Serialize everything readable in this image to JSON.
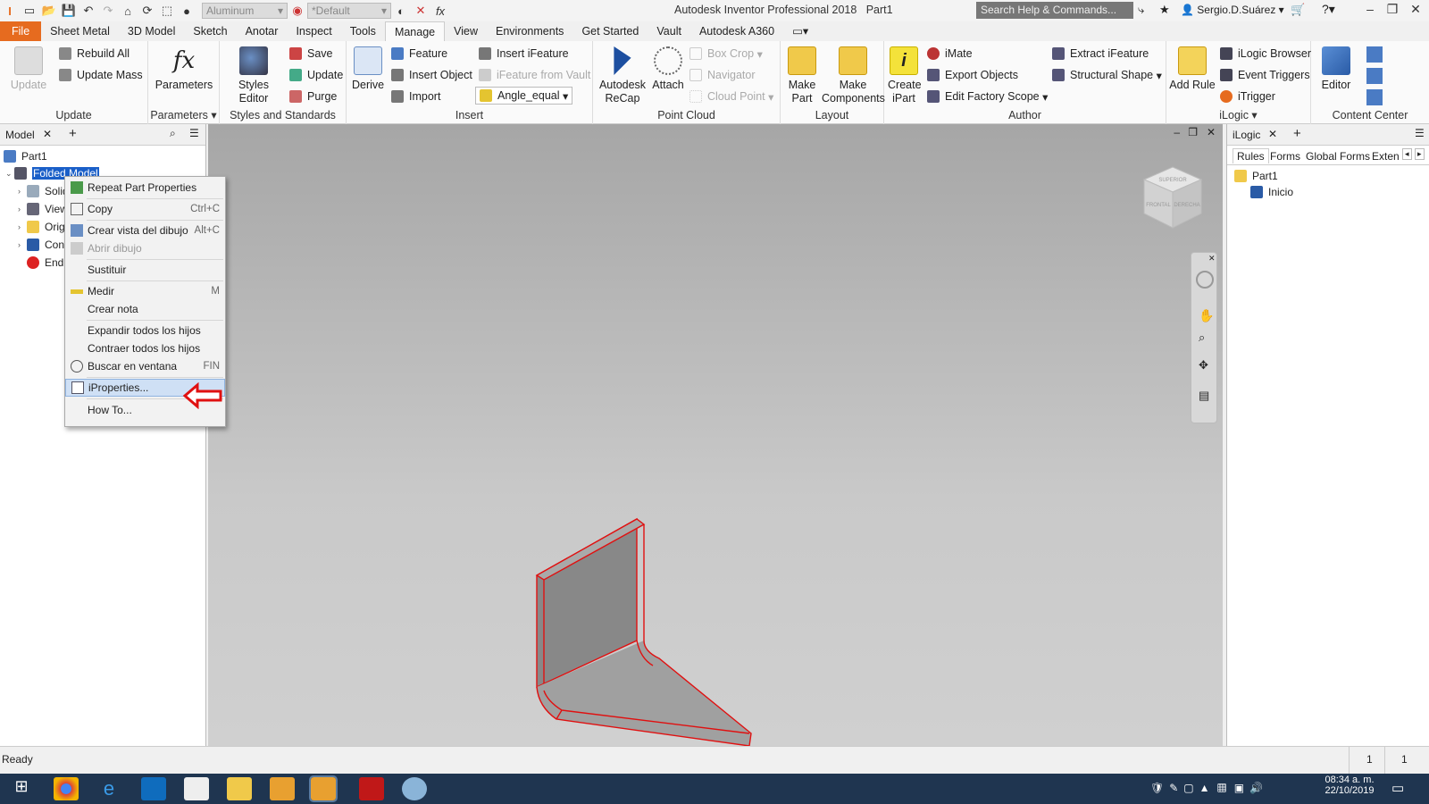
{
  "app": {
    "title": "Autodesk Inventor Professional 2018",
    "document": "Part1",
    "search_placeholder": "Search Help & Commands...",
    "user": "Sergio.D.Suárez",
    "material": "Aluminum",
    "appearance": "*Default"
  },
  "tabs": [
    "File",
    "Sheet Metal",
    "3D Model",
    "Sketch",
    "Anotar",
    "Inspect",
    "Tools",
    "Manage",
    "View",
    "Environments",
    "Get Started",
    "Vault",
    "Autodesk A360"
  ],
  "active_tab": "Manage",
  "ribbon": {
    "update": {
      "label": "Update",
      "rebuild_all": "Rebuild All",
      "update_mass": "Update Mass",
      "group": "Update"
    },
    "parameters": {
      "label": "Parameters",
      "group": "Parameters"
    },
    "styles": {
      "styles_editor": "Styles Editor",
      "save": "Save",
      "update": "Update",
      "purge": "Purge",
      "group": "Styles and Standards"
    },
    "insert": {
      "derive": "Derive",
      "feature": "Feature",
      "insert_object": "Insert Object",
      "import": "Import",
      "insert_ifeature": "Insert iFeature",
      "ifeature_from_vault": "iFeature from Vault",
      "angle_dropdown": "Angle_equal",
      "group": "Insert"
    },
    "point_cloud": {
      "recap": "Autodesk ReCap",
      "attach": "Attach",
      "box_crop": "Box Crop",
      "navigator": "Navigator",
      "cloud_point": "Cloud Point",
      "group": "Point Cloud"
    },
    "layout": {
      "make_part": "Make Part",
      "make_components": "Make Components",
      "group": "Layout"
    },
    "author": {
      "create_ipart": "Create iPart",
      "imate": "iMate",
      "export_objects": "Export Objects",
      "edit_factory_scope": "Edit Factory Scope",
      "extract_ifeature": "Extract iFeature",
      "structural_shape": "Structural Shape",
      "group": "Author"
    },
    "ilogic": {
      "add_rule": "Add Rule",
      "browser": "iLogic Browser",
      "event_triggers": "Event Triggers",
      "itrigger": "iTrigger",
      "group": "iLogic"
    },
    "content_center": {
      "editor": "Editor",
      "group": "Content Center"
    }
  },
  "model_panel": {
    "tab": "Model",
    "root": "Part1",
    "items": [
      "Folded Model",
      "Solid",
      "View",
      "Orig",
      "Con",
      "End"
    ]
  },
  "context_menu": {
    "items": [
      {
        "label": "Repeat Part Properties",
        "shortcut": ""
      },
      {
        "label": "Copy",
        "shortcut": "Ctrl+C"
      },
      {
        "label": "Crear vista del dibujo",
        "shortcut": "Alt+C"
      },
      {
        "label": "Abrir dibujo",
        "shortcut": ""
      },
      {
        "label": "Sustituir",
        "shortcut": ""
      },
      {
        "label": "Medir",
        "shortcut": "M"
      },
      {
        "label": "Crear nota",
        "shortcut": ""
      },
      {
        "label": "Expandir todos los hijos",
        "shortcut": ""
      },
      {
        "label": "Contraer todos los hijos",
        "shortcut": ""
      },
      {
        "label": "Buscar en ventana",
        "shortcut": "FIN"
      },
      {
        "label": "iProperties...",
        "shortcut": ""
      },
      {
        "label": "How To...",
        "shortcut": ""
      }
    ]
  },
  "viewcube": {
    "top": "SUPERIOR",
    "front": "FRONTAL",
    "right": "DERECHA"
  },
  "ilogic_panel": {
    "title": "iLogic",
    "tabs": [
      "Rules",
      "Forms",
      "Global Forms",
      "Exten"
    ],
    "root": "Part1",
    "rule": "Inicio"
  },
  "status": {
    "text": "Ready",
    "count1": "1",
    "count2": "1"
  },
  "clock": {
    "time": "08:34 a. m.",
    "date": "22/10/2019"
  }
}
